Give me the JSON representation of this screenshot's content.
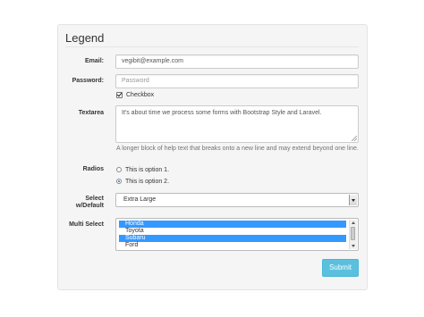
{
  "form": {
    "legend": "Legend",
    "email": {
      "label": "Email:",
      "value": "vegibit@example.com"
    },
    "password": {
      "label": "Password:",
      "placeholder": "Password"
    },
    "checkbox": {
      "label": "Checkbox",
      "checked": true
    },
    "textarea": {
      "label": "Textarea",
      "value": "It's about time we process some forms with Bootstrap Style and Laravel.",
      "help": "A longer block of help text that breaks onto a new line and may extend beyond one line."
    },
    "radios": {
      "label": "Radios",
      "options": [
        "This is option 1.",
        "This is option 2."
      ],
      "selected_index": 1
    },
    "select_default": {
      "label_line1": "Select",
      "label_line2": "w/Default",
      "value": "Extra Large"
    },
    "multi_select": {
      "label": "Multi Select",
      "options": [
        {
          "label": "Honda",
          "selected": true
        },
        {
          "label": "Toyota",
          "selected": false
        },
        {
          "label": "Subaru",
          "selected": true
        },
        {
          "label": "Ford",
          "selected": false
        }
      ]
    },
    "submit_label": "Submit"
  },
  "colors": {
    "panel_bg": "#f5f5f5",
    "selection": "#3399ff",
    "submit_bg": "#5bc0de"
  }
}
